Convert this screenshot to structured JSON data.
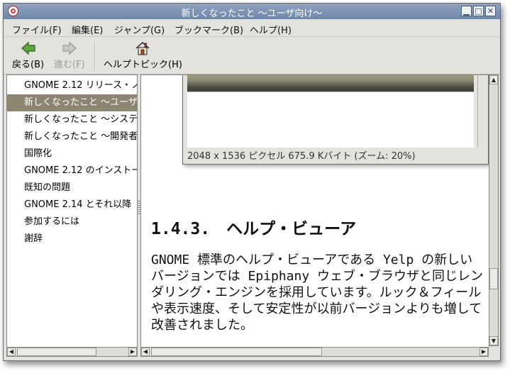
{
  "window": {
    "title": "新しくなったこと 〜ユーザ向け〜",
    "controls": {
      "minimize": "▁",
      "maximize": "□",
      "close": "✕"
    }
  },
  "menu": {
    "items": [
      "ファイル(F)",
      "編集(E)",
      "ジャンプ(G)",
      "ブックマーク(B)",
      "ヘルプ(H)"
    ]
  },
  "toolbar": {
    "back": {
      "label": "戻る(B)",
      "icon": "arrow-left-icon",
      "enabled": true
    },
    "forward": {
      "label": "進む(F)",
      "icon": "arrow-right-icon",
      "enabled": false
    },
    "help_topics": {
      "label": "ヘルプトピック(H)",
      "icon": "home-icon"
    }
  },
  "sidebar": {
    "items": [
      {
        "label": "GNOME 2.12 リリース・ノ",
        "selected": false
      },
      {
        "label": "新しくなったこと 〜ユーザ",
        "selected": true
      },
      {
        "label": "新しくなったこと 〜システ",
        "selected": false
      },
      {
        "label": "新しくなったこと 〜開発者",
        "selected": false
      },
      {
        "label": "国際化",
        "selected": false
      },
      {
        "label": "GNOME 2.12 のインストー",
        "selected": false
      },
      {
        "label": "既知の問題",
        "selected": false
      },
      {
        "label": "GNOME 2.14 とそれ以降",
        "selected": false
      },
      {
        "label": "参加するには",
        "selected": false
      },
      {
        "label": "謝辞",
        "selected": false
      }
    ]
  },
  "content": {
    "screenshot_caption": "2048 x 1536 ピクセル  675.9 Kバイト (ズーム: 20%)",
    "heading": "1.4.3.　ヘルプ・ビューア",
    "paragraph": "GNOME 標準のヘルプ・ビューアである Yelp の新しいバージョンでは Epiphany ウェブ・ブラウザと同じレンダリング・エンジンを採用しています。ルック＆フィールや表示速度、そして安定性が以前バージョンよりも増して改善されました。"
  },
  "colors": {
    "titlebar": "#7d92b3",
    "selection": "#8b8571",
    "window_bg": "#e4e2dd"
  }
}
